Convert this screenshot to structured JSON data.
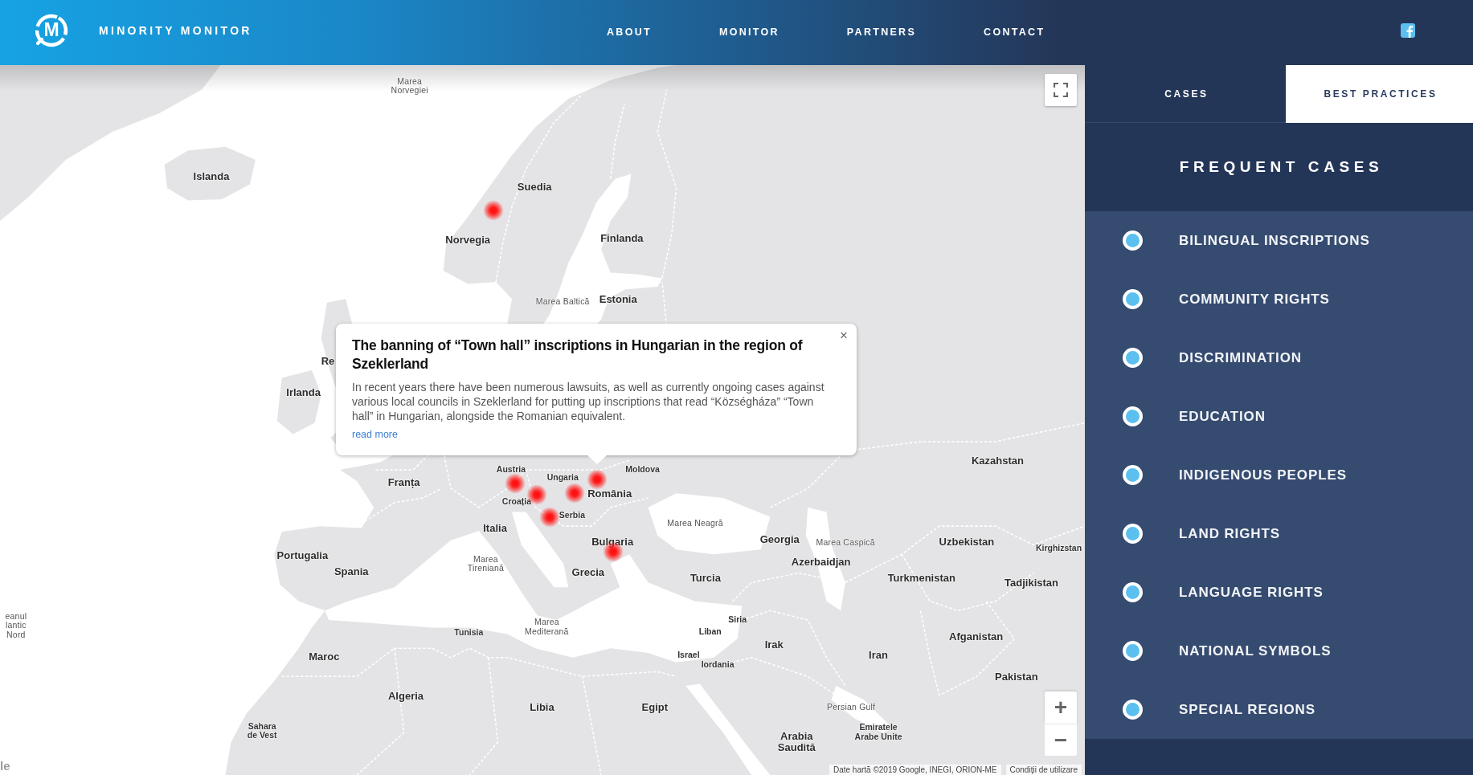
{
  "header": {
    "logo_letter": "M",
    "brand": "MINORITY MONITOR",
    "nav": [
      "ABOUT",
      "MONITOR",
      "PARTNERS",
      "CONTACT"
    ]
  },
  "map": {
    "labels": [
      {
        "text": "Marea\nNorvegiei",
        "kind": "sea"
      },
      {
        "text": "Islanda",
        "kind": "country"
      },
      {
        "text": "Suedia",
        "kind": "country"
      },
      {
        "text": "Norvegia",
        "kind": "country"
      },
      {
        "text": "Finlanda",
        "kind": "country"
      },
      {
        "text": "Marea Baltică",
        "kind": "sea"
      },
      {
        "text": "Estonia",
        "kind": "country"
      },
      {
        "text": "Re",
        "kind": "country"
      },
      {
        "text": "Irlanda",
        "kind": "country"
      },
      {
        "text": "Kazahstan",
        "kind": "country"
      },
      {
        "text": "Austria",
        "kind": "minor"
      },
      {
        "text": "Franța",
        "kind": "country"
      },
      {
        "text": "Ungaria",
        "kind": "minor"
      },
      {
        "text": "Moldova",
        "kind": "minor"
      },
      {
        "text": "Croația",
        "kind": "minor"
      },
      {
        "text": "România",
        "kind": "country"
      },
      {
        "text": "Serbia",
        "kind": "minor"
      },
      {
        "text": "Italia",
        "kind": "country"
      },
      {
        "text": "Marea Neagră",
        "kind": "sea"
      },
      {
        "text": "Bulgaria",
        "kind": "country"
      },
      {
        "text": "Georgia",
        "kind": "country"
      },
      {
        "text": "Marea Caspică",
        "kind": "sea"
      },
      {
        "text": "Uzbekistan",
        "kind": "country"
      },
      {
        "text": "Portugalia",
        "kind": "country"
      },
      {
        "text": "Kirghizstan",
        "kind": "minor"
      },
      {
        "text": "Spania",
        "kind": "country"
      },
      {
        "text": "Marea\nTireniană",
        "kind": "sea"
      },
      {
        "text": "Grecia",
        "kind": "country"
      },
      {
        "text": "Azerbaidjan",
        "kind": "country"
      },
      {
        "text": "Turcia",
        "kind": "country"
      },
      {
        "text": "Turkmenistan",
        "kind": "country"
      },
      {
        "text": "Tadjikistan",
        "kind": "country"
      },
      {
        "text": "eanul\nlantic\nNord",
        "kind": "sea"
      },
      {
        "text": "Tunisia",
        "kind": "minor"
      },
      {
        "text": "Marea\nMediterană",
        "kind": "sea"
      },
      {
        "text": "Siria",
        "kind": "minor"
      },
      {
        "text": "Liban",
        "kind": "minor"
      },
      {
        "text": "Maroc",
        "kind": "country"
      },
      {
        "text": "Israel",
        "kind": "minor"
      },
      {
        "text": "Iordania",
        "kind": "minor"
      },
      {
        "text": "Irak",
        "kind": "country"
      },
      {
        "text": "Afganistan",
        "kind": "country"
      },
      {
        "text": "Iran",
        "kind": "country"
      },
      {
        "text": "Pakistan",
        "kind": "country"
      },
      {
        "text": "Algeria",
        "kind": "country"
      },
      {
        "text": "Libia",
        "kind": "country"
      },
      {
        "text": "Egipt",
        "kind": "country"
      },
      {
        "text": "Persian Gulf",
        "kind": "sea"
      },
      {
        "text": "Sahara\nde Vest",
        "kind": "minor"
      },
      {
        "text": "Arabia\nSaudită",
        "kind": "country"
      },
      {
        "text": "Emiratele\nArabe Unite",
        "kind": "minor"
      }
    ],
    "popup": {
      "title": "The banning of “Town hall” inscriptions in Hungarian in the region of Szeklerland",
      "text": "In recent years there have been numerous lawsuits, as well as currently ongoing cases against various local councils in Szeklerland for putting up inscriptions that read “Községháza” “Town hall” in Hungarian, alongside the Romanian equivalent.",
      "link": "read more",
      "close": "×"
    },
    "zoom_in": "+",
    "zoom_out": "−",
    "logo": "le",
    "attribution": "Date hartă ©2019 Google, INEGI, ORION-ME",
    "terms": "Condiții de utilizare"
  },
  "sidebar": {
    "tabs": [
      {
        "label": "CASES",
        "selected": true
      },
      {
        "label": "BEST PRACTICES",
        "selected": false
      }
    ],
    "heading": "FREQUENT CASES",
    "items": [
      "BILINGUAL INSCRIPTIONS",
      "COMMUNITY RIGHTS",
      "DISCRIMINATION",
      "EDUCATION",
      "INDIGENOUS PEOPLES",
      "LAND RIGHTS",
      "LANGUAGE RIGHTS",
      "NATIONAL SYMBOLS",
      "SPECIAL REGIONS"
    ]
  }
}
